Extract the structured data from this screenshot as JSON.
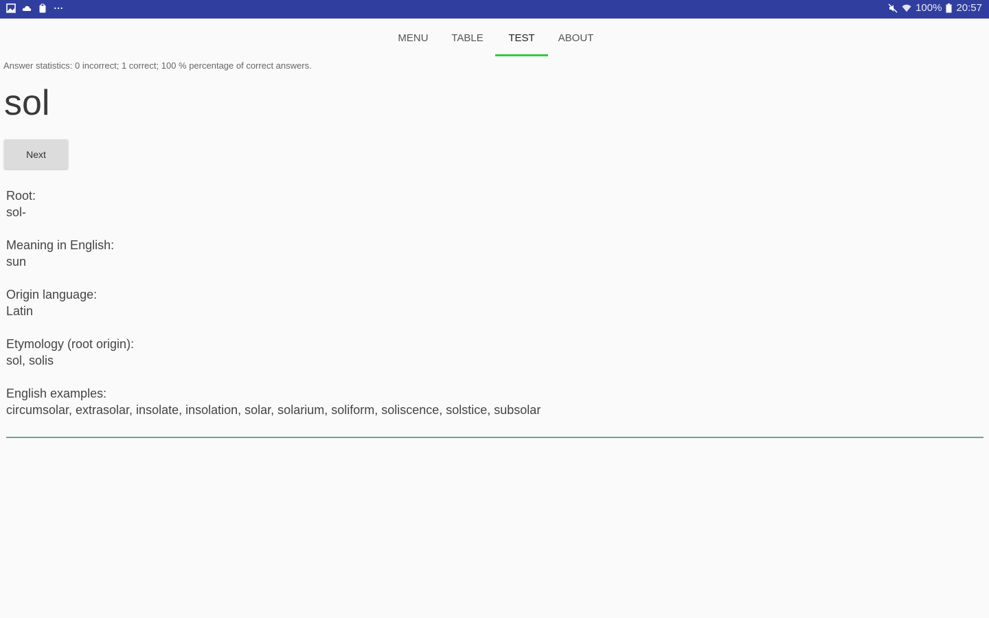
{
  "status_bar": {
    "left_icons": [
      "gallery-icon",
      "cloud-icon",
      "clipboard-icon",
      "more-icon"
    ],
    "right_icons": [
      "mute-icon",
      "wifi-icon",
      "battery-icon"
    ],
    "battery": "100%",
    "time": "20:57",
    "bg_color": "#303f9f"
  },
  "tabs": [
    {
      "label": "MENU",
      "active": false
    },
    {
      "label": "TABLE",
      "active": false
    },
    {
      "label": "TEST",
      "active": true
    },
    {
      "label": "ABOUT",
      "active": false
    }
  ],
  "accent_color": "#2ecc40",
  "stats": "Answer statistics: 0 incorrect; 1 correct; 100 % percentage of correct answers.",
  "word": "sol",
  "next_label": "Next",
  "details": [
    {
      "label": "Root:",
      "value": "sol-"
    },
    {
      "label": "Meaning in English:",
      "value": "sun"
    },
    {
      "label": "Origin language:",
      "value": "Latin"
    },
    {
      "label": "Etymology (root origin):",
      "value": "sol, solis"
    },
    {
      "label": "English examples:",
      "value": "circumsolar, extrasolar, insolate, insolation, solar, solarium, soliform, soliscence, solstice, subsolar"
    }
  ],
  "answer_input": {
    "value": ""
  }
}
